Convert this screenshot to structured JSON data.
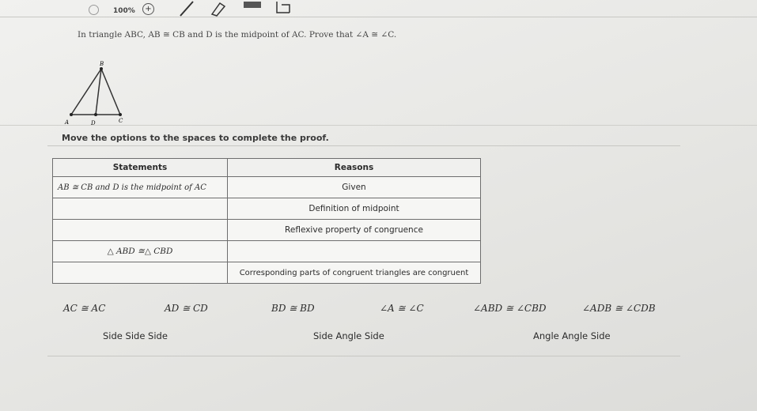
{
  "toolbar": {
    "zoom": "100%",
    "zoom_in": "+"
  },
  "problem": {
    "text": "In triangle ABC, AB ≅ CB and D is the midpoint of AC. Prove that ∠A ≅ ∠C."
  },
  "figure": {
    "labels": {
      "top": "B",
      "left": "A",
      "mid": "D",
      "right": "C"
    }
  },
  "instructions": "Move the options to the spaces to complete the proof.",
  "proof": {
    "headers": {
      "statements": "Statements",
      "reasons": "Reasons"
    },
    "rows": [
      {
        "statement": "AB ≅ CB and D is the midpoint of AC",
        "reason": "Given"
      },
      {
        "statement": "",
        "reason": "Definition of midpoint"
      },
      {
        "statement": "",
        "reason": "Reflexive property of congruence"
      },
      {
        "statement": "△ ABD ≅△ CBD",
        "reason": ""
      },
      {
        "statement": "",
        "reason": "Corresponding parts of congruent triangles are congruent"
      }
    ]
  },
  "options": {
    "statements": [
      "AC ≅ AC",
      "AD ≅ CD",
      "BD ≅ BD",
      "∠A ≅ ∠C",
      "∠ABD ≅ ∠CBD",
      "∠ADB ≅ ∠CDB"
    ],
    "reasons": [
      "Side Side Side",
      "Side Angle Side",
      "Angle Angle Side"
    ]
  }
}
